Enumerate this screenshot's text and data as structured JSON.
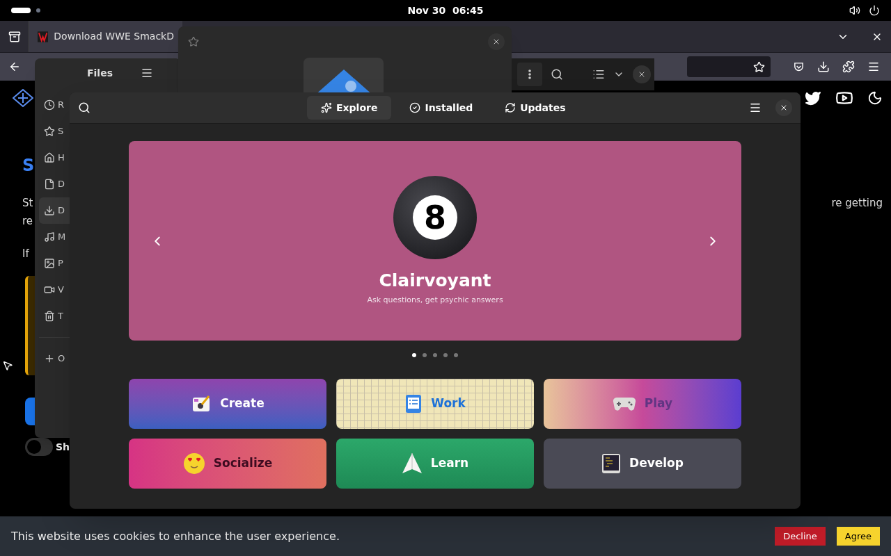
{
  "top_bar": {
    "clock": "Nov 30  06:45"
  },
  "browser": {
    "tab": {
      "title": "Download WWE SmackD",
      "selected": true
    },
    "page": {
      "heading": "S",
      "line_1_start": "St",
      "line_1_end": "re getting",
      "line_2": "re",
      "line_3": "If",
      "toggle": {
        "label": "Sh",
        "on": false
      }
    },
    "cookie_banner": {
      "text": "This website uses cookies to enhance the user experience.",
      "buttons": [
        {
          "label": "Decline",
          "kind": "decline"
        },
        {
          "label": "Agree",
          "kind": "agree"
        }
      ]
    }
  },
  "files_window": {
    "title": "Files",
    "sidebar": [
      {
        "label": "R",
        "kind": "recent",
        "selected": false
      },
      {
        "label": "S",
        "kind": "starred",
        "selected": false
      },
      {
        "label": "H",
        "kind": "home",
        "selected": false
      },
      {
        "label": "D",
        "kind": "documents",
        "selected": false
      },
      {
        "label": "D",
        "kind": "downloads",
        "selected": true
      },
      {
        "label": "M",
        "kind": "music",
        "selected": false
      },
      {
        "label": "P",
        "kind": "pictures",
        "selected": false
      },
      {
        "label": "V",
        "kind": "videos",
        "selected": false
      },
      {
        "label": "T",
        "kind": "trash",
        "selected": false
      },
      {
        "label": "O",
        "kind": "other",
        "selected": false
      }
    ]
  },
  "software_window": {
    "tabs": [
      {
        "label": "Explore",
        "kind": "explore",
        "selected": true
      },
      {
        "label": "Installed",
        "kind": "installed",
        "selected": false
      },
      {
        "label": "Updates",
        "kind": "updates",
        "selected": false
      }
    ],
    "featured": {
      "badge": "8",
      "title": "Clairvoyant",
      "subtitle": "Ask questions, get psychic answers"
    },
    "carousel_dots": [
      {
        "selected": true
      },
      {
        "selected": false
      },
      {
        "selected": false
      },
      {
        "selected": false
      },
      {
        "selected": false
      }
    ],
    "categories": [
      {
        "label": "Create",
        "kind": "create"
      },
      {
        "label": "Work",
        "kind": "work"
      },
      {
        "label": "Play",
        "kind": "play"
      },
      {
        "label": "Socialize",
        "kind": "socialize"
      },
      {
        "label": "Learn",
        "kind": "learn"
      },
      {
        "label": "Develop",
        "kind": "develop"
      }
    ]
  }
}
